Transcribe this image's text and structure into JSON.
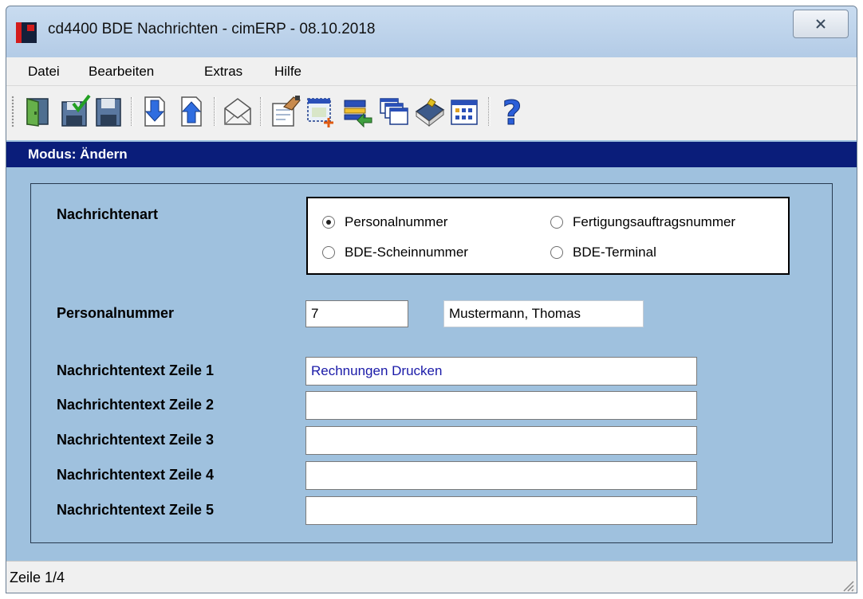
{
  "window": {
    "title": "cd4400 BDE Nachrichten - cimERP - 08.10.2018"
  },
  "menu": [
    {
      "label": "Datei"
    },
    {
      "label": "Bearbeiten"
    },
    {
      "label": "Extras"
    },
    {
      "label": "Hilfe"
    }
  ],
  "toolbar": {
    "buttons": [
      "exit-door",
      "save-check",
      "save",
      "arrow-down",
      "arrow-up",
      "envelope",
      "edit-hand",
      "new-window",
      "list-arrow",
      "windows",
      "book",
      "grid-table",
      "help"
    ]
  },
  "mode": "Modus: Ändern",
  "form": {
    "nachrichtenart_label": "Nachrichtenart",
    "radio_options": [
      {
        "label": "Personalnummer",
        "selected": true
      },
      {
        "label": "Fertigungsauftragsnummer",
        "selected": false
      },
      {
        "label": "BDE-Scheinnummer",
        "selected": false
      },
      {
        "label": "BDE-Terminal",
        "selected": false
      }
    ],
    "personalnummer_label": "Personalnummer",
    "personalnummer_value": "7",
    "personalname_value": "Mustermann, Thomas",
    "text_lines": [
      {
        "label": "Nachrichtentext Zeile 1",
        "value": "Rechnungen Drucken"
      },
      {
        "label": "Nachrichtentext Zeile 2",
        "value": ""
      },
      {
        "label": "Nachrichtentext Zeile 3",
        "value": ""
      },
      {
        "label": "Nachrichtentext Zeile 4",
        "value": ""
      },
      {
        "label": "Nachrichtentext Zeile 5",
        "value": ""
      }
    ]
  },
  "status": "Zeile 1/4",
  "colors": {
    "background": "#9fc1de",
    "mode_bar": "#0a1d7a",
    "text_blue": "#1a1aa8",
    "accent_red": "#d31c1c"
  }
}
